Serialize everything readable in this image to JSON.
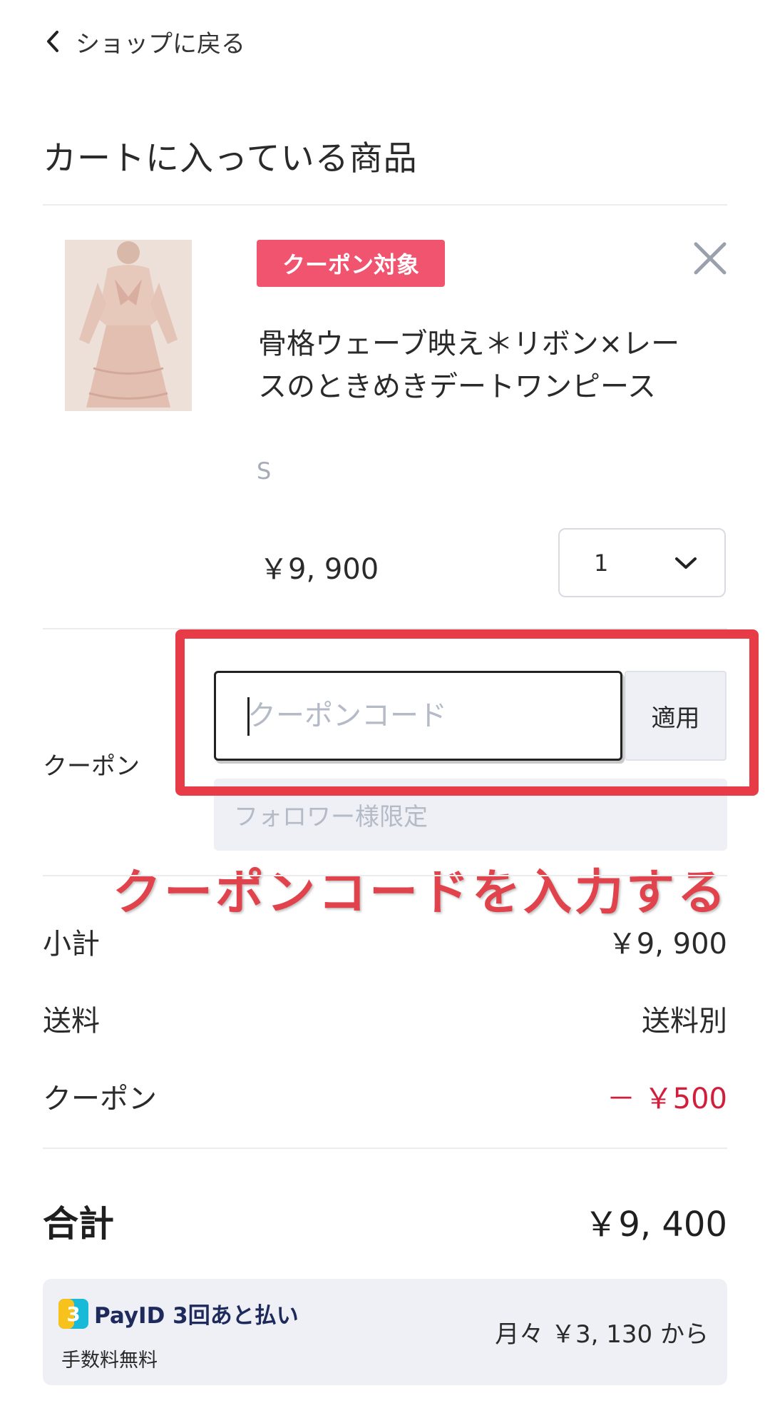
{
  "header": {
    "back_label": "ショップに戻る",
    "back_icon": "chevron-left-icon"
  },
  "cart": {
    "title": "カートに入っている商品",
    "item": {
      "badge": "クーポン対象",
      "name": "骨格ウェーブ映え＊リボン×レースのときめきデートワンピース",
      "variant": "S",
      "price": "￥9, 900",
      "quantity": "1",
      "remove_icon": "close-icon"
    }
  },
  "coupon": {
    "label": "クーポン",
    "placeholder": "クーポンコード",
    "apply_label": "適用",
    "note": "フォロワー様限定",
    "annotation": "クーポンコードを入力する",
    "highlight_color": "#e73c47"
  },
  "summary": {
    "subtotal_label": "小計",
    "subtotal_value": "￥9, 900",
    "shipping_label": "送料",
    "shipping_value": "送料別",
    "coupon_label": "クーポン",
    "coupon_value": "－ ￥500",
    "total_label": "合計",
    "total_value": "￥9, 400"
  },
  "payid": {
    "title": "PayID 3回あと払い",
    "subtitle": "手数料無料",
    "monthly": "月々 ￥3, 130 から",
    "logo_colors": [
      "#f7c21b",
      "#19b9d8"
    ]
  },
  "colors": {
    "badge": "#f0546f",
    "discount": "#d21d3b",
    "annotation": "#e0434b"
  }
}
